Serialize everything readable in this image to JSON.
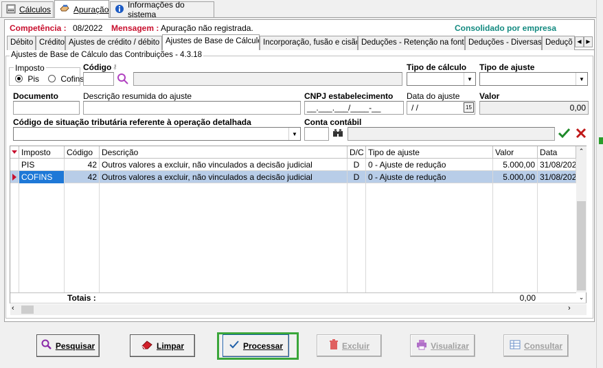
{
  "top_tabs": [
    {
      "label": "Cálculos",
      "icon": "calculator-icon"
    },
    {
      "label": "Apuração",
      "icon": "hand-icon"
    },
    {
      "label": "Informações do sistema",
      "icon": "info-icon"
    }
  ],
  "infobar": {
    "competencia_label": "Competência :",
    "competencia_value": "08/2022",
    "mensagem_label": "Mensagem :",
    "mensagem_value": "Apuração não registrada.",
    "consolidado": "Consolidado por empresa"
  },
  "sub_tabs": [
    "Débito",
    "Crédito",
    "Ajustes de crédito / débito",
    "Ajustes de Base de Cálculo",
    "Incorporação, fusão e cisão",
    "Deduções - Retenção na fonte",
    "Deduções - Diversas",
    "Deduçõ"
  ],
  "group_title": "Ajustes de Base de Cálculo das Contribuições - 4.3.18",
  "form": {
    "imposto_label": "Imposto",
    "radio_pis": "Pis",
    "radio_cofins": "Cofins",
    "codigo_label": "Código",
    "tipo_calculo_label": "Tipo de cálculo",
    "tipo_ajuste_label": "Tipo de ajuste",
    "documento_label": "Documento",
    "descricao_label": "Descrição resumida do ajuste",
    "cnpj_label": "CNPJ estabelecimento",
    "cnpj_mask": "__.___.___/____-__",
    "data_label": "Data do ajuste",
    "data_mask": " / /",
    "calendar_day": "15",
    "valor_label": "Valor",
    "valor_value": "0,00",
    "cst_label": "Código de situação tributária referente à operação detalhada",
    "conta_label": "Conta contábil"
  },
  "grid": {
    "columns": [
      "Imposto",
      "Código",
      "Descrição",
      "D/C",
      "Tipo de ajuste",
      "Valor",
      "Data"
    ],
    "rows": [
      [
        "PIS",
        "42",
        "Outros valores a excluir, não vinculados a decisão judicial",
        "D",
        "0 - Ajuste de redução",
        "5.000,00",
        "31/08/202"
      ],
      [
        "COFINS",
        "42",
        "Outros valores a excluir, não vinculados a decisão judicial",
        "D",
        "0 - Ajuste de redução",
        "5.000,00",
        "31/08/202"
      ]
    ],
    "totals_label": "Totais :",
    "totals_value": "0,00"
  },
  "buttons": {
    "pesquisar": "Pesquisar",
    "limpar": "Limpar",
    "processar": "Processar",
    "excluir": "Excluir",
    "visualizar": "Visualizar",
    "consultar": "Consultar"
  },
  "colors": {
    "accent_red": "#c8102e",
    "accent_teal": "#138a80",
    "highlight_green": "#3aa63a",
    "selection": "#b8cde8"
  }
}
